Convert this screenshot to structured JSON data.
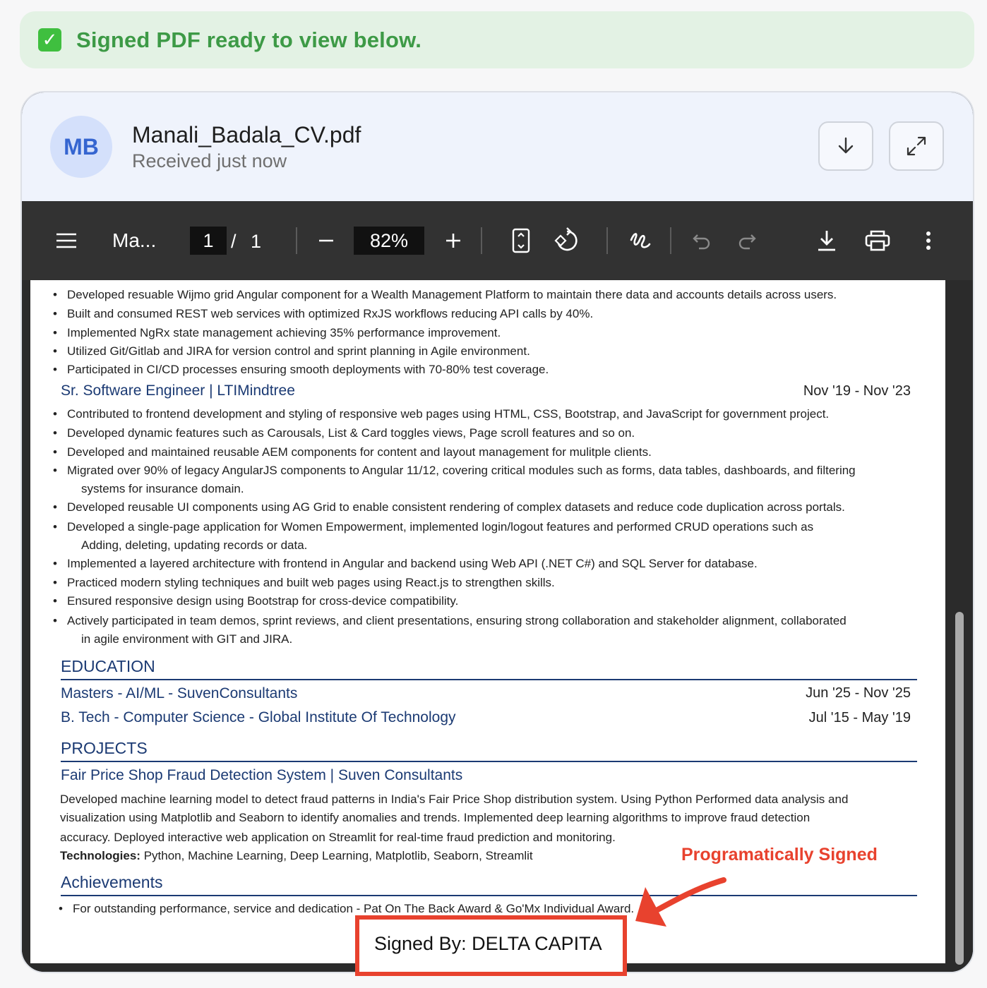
{
  "banner": {
    "text": "Signed PDF ready to view below."
  },
  "header": {
    "avatar_initials": "MB",
    "file_name": "Manali_Badala_CV.pdf",
    "received": "Received just now"
  },
  "toolbar": {
    "title": "Ma...",
    "page_current": "1",
    "page_sep": "/",
    "page_total": "1",
    "zoom": "82%"
  },
  "doc": {
    "bullets_top": [
      "Developed resuable Wijmo grid Angular component for a Wealth Management Platform to maintain there data and accounts details across users.",
      "Built and consumed REST web services with optimized RxJS workflows reducing API calls by 40%.",
      "Implemented NgRx state management achieving 35% performance improvement.",
      "Utilized Git/Gitlab and JIRA for version control and sprint planning in Agile environment.",
      "Participated in CI/CD processes ensuring smooth deployments with 70-80% test coverage."
    ],
    "job2_title": "Sr. Software Engineer | LTIMindtree",
    "job2_dates": "Nov '19  -  Nov '23",
    "job2_bullets": [
      "Contributed to frontend development and styling of responsive web pages using HTML, CSS, Bootstrap, and JavaScript for government project.",
      "Developed dynamic features such as Carousals, List & Card toggles views, Page scroll features and so on.",
      "Developed and maintained reusable AEM components for content and layout management for mulitple clients.",
      "Migrated over 90% of legacy AngularJS components to Angular 11/12, covering critical modules such as forms, data tables, dashboards, and filtering",
      "systems for insurance domain.",
      "Developed reusable UI components using AG Grid to enable consistent rendering of complex datasets and reduce code duplication across portals.",
      "Developed a single-page application for Women Empowerment, implemented login/logout features and performed CRUD operations such as",
      "Adding, deleting, updating records or data.",
      "Implemented a layered architecture with frontend in Angular and backend using Web API (.NET C#) and SQL Server for database.",
      "Practiced modern styling techniques and built web pages using React.js to strengthen skills.",
      "Ensured responsive design using Bootstrap for cross-device compatibility.",
      "Actively participated in team demos, sprint reviews, and client presentations, ensuring strong collaboration and stakeholder alignment, collaborated",
      "in agile environment with GIT and JIRA."
    ],
    "education_heading": "EDUCATION",
    "edu1_title": "Masters - AI/ML - SuvenConsultants",
    "edu1_dates": "Jun '25  -  Nov '25",
    "edu2_title": "B. Tech - Computer Science - Global Institute Of Technology",
    "edu2_dates": "Jul '15  -  May '19",
    "projects_heading": "PROJECTS",
    "proj_title": "Fair Price Shop Fraud Detection System | Suven Consultants",
    "proj_para": [
      "Developed machine learning model to detect fraud patterns in India's Fair Price Shop distribution system. Using Python Performed data analysis and",
      "visualization using Matplotlib and Seaborn to identify anomalies and trends. Implemented deep learning algorithms to improve fraud detection",
      "accuracy. Deployed interactive web application on Streamlit for real-time fraud prediction and monitoring."
    ],
    "proj_tech_label": "Technologies:",
    "proj_tech": " Python, Machine Learning, Deep Learning, Matplotlib, Seaborn, Streamlit",
    "achievements_heading": "Achievements",
    "achievement": "For outstanding performance, service and dedication - Pat  On  The  Back Award & Go'Mx Individual Award."
  },
  "annotation": {
    "label": "Programatically Signed",
    "signed_by": "Signed By: DELTA CAPITA",
    "color": "#e8422e"
  }
}
